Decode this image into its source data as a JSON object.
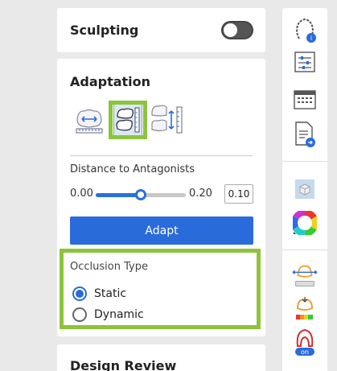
{
  "sculpting": {
    "title": "Sculpting",
    "enabled": false
  },
  "adaptation": {
    "title": "Adaptation",
    "modes": [
      {
        "icon": "horizontal-adapt-icon",
        "selected": false
      },
      {
        "icon": "antagonist-distance-icon",
        "selected": true
      },
      {
        "icon": "vertical-adapt-icon",
        "selected": false
      }
    ],
    "distance_label": "Distance to Antagonists",
    "slider_min": "0.00",
    "slider_max": "0.20",
    "slider_value": "0.10",
    "slider_fraction": 0.5,
    "adapt_button": "Adapt",
    "occlusion": {
      "label": "Occlusion Type",
      "options": [
        {
          "label": "Static",
          "checked": true
        },
        {
          "label": "Dynamic",
          "checked": false
        }
      ]
    }
  },
  "design_review": {
    "title": "Design Review"
  },
  "toolbar": {
    "items": [
      "jaw-info-icon",
      "settings-sliders-icon",
      "keyboard-icon",
      "document-export-icon",
      "cube-view-icon",
      "color-wheel-icon",
      "occlusion-compass-icon",
      "distance-color-map-icon",
      "tooth-section-on-icon"
    ],
    "toggle_on_label": "on"
  },
  "colors": {
    "accent": "#2a6bdc",
    "highlight": "#8cc43c"
  }
}
